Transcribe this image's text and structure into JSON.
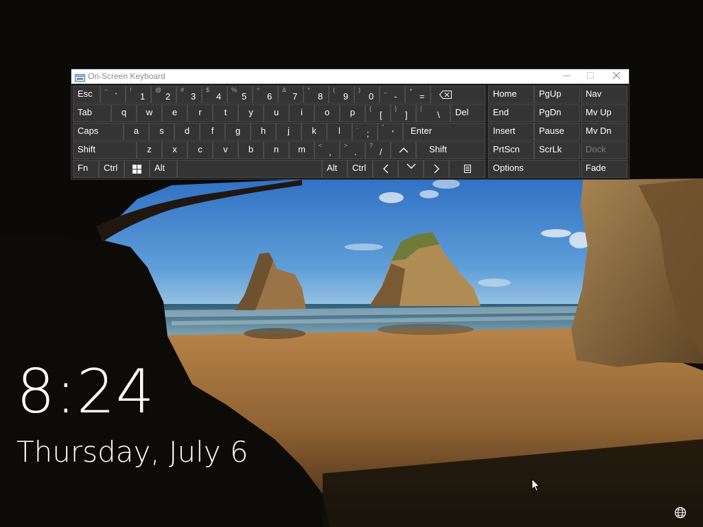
{
  "window": {
    "title": "On-Screen Keyboard",
    "minimize_label": "—",
    "maximize_label": "☐",
    "close_label": "✕"
  },
  "keyboard": {
    "row1": {
      "esc": "Esc",
      "num_keys": [
        {
          "shift": "~",
          "main": "`"
        },
        {
          "shift": "!",
          "main": "1"
        },
        {
          "shift": "@",
          "main": "2"
        },
        {
          "shift": "#",
          "main": "3"
        },
        {
          "shift": "$",
          "main": "4"
        },
        {
          "shift": "%",
          "main": "5"
        },
        {
          "shift": "^",
          "main": "6"
        },
        {
          "shift": "&",
          "main": "7"
        },
        {
          "shift": "*",
          "main": "8"
        },
        {
          "shift": "(",
          "main": "9"
        },
        {
          "shift": ")",
          "main": "0"
        },
        {
          "shift": "_",
          "main": "-"
        },
        {
          "shift": "+",
          "main": "="
        }
      ]
    },
    "row2": {
      "tab": "Tab",
      "letters": [
        "q",
        "w",
        "e",
        "r",
        "t",
        "y",
        "u",
        "i",
        "o",
        "p"
      ],
      "bracket_keys": [
        {
          "shift": "{",
          "main": "["
        },
        {
          "shift": "}",
          "main": "]"
        },
        {
          "shift": "|",
          "main": "\\"
        }
      ],
      "del": "Del"
    },
    "row3": {
      "caps": "Caps",
      "letters": [
        "a",
        "s",
        "d",
        "f",
        "g",
        "h",
        "j",
        "k",
        "l"
      ],
      "punct_keys": [
        {
          "shift": ":",
          "main": ";"
        },
        {
          "shift": "\"",
          "main": "'"
        }
      ],
      "enter": "Enter"
    },
    "row4": {
      "shift_left": "Shift",
      "letters": [
        "z",
        "x",
        "c",
        "v",
        "b",
        "n",
        "m"
      ],
      "punct_keys": [
        {
          "shift": "<",
          "main": ","
        },
        {
          "shift": ">",
          "main": "."
        },
        {
          "shift": "?",
          "main": "/"
        }
      ],
      "shift_right": "Shift"
    },
    "row5": {
      "fn": "Fn",
      "ctrl_left": "Ctrl",
      "alt_left": "Alt",
      "alt_right": "Alt",
      "ctrl_right": "Ctrl"
    },
    "nav": {
      "home": "Home",
      "pgup": "PgUp",
      "nav": "Nav",
      "end": "End",
      "pgdn": "PgDn",
      "mvup": "Mv Up",
      "insert": "Insert",
      "pause": "Pause",
      "mvdn": "Mv Dn",
      "prtscn": "PrtScn",
      "scrlk": "ScrLk",
      "dock": "Dock",
      "options": "Options",
      "fade": "Fade"
    }
  },
  "lockscreen": {
    "time": "8:24",
    "date": "Thursday, July 6"
  },
  "icons": {
    "keyboard": "keyboard-icon",
    "windows": "windows-logo-icon",
    "backspace": "backspace-icon",
    "menu": "context-menu-icon",
    "network": "globe-network-icon",
    "cursor": "mouse-pointer-icon"
  },
  "colors": {
    "key_bg": "#343434",
    "key_border": "#4b4b4b",
    "osk_bg": "#1f1f1f",
    "titlebar_bg": "#ffffff"
  }
}
